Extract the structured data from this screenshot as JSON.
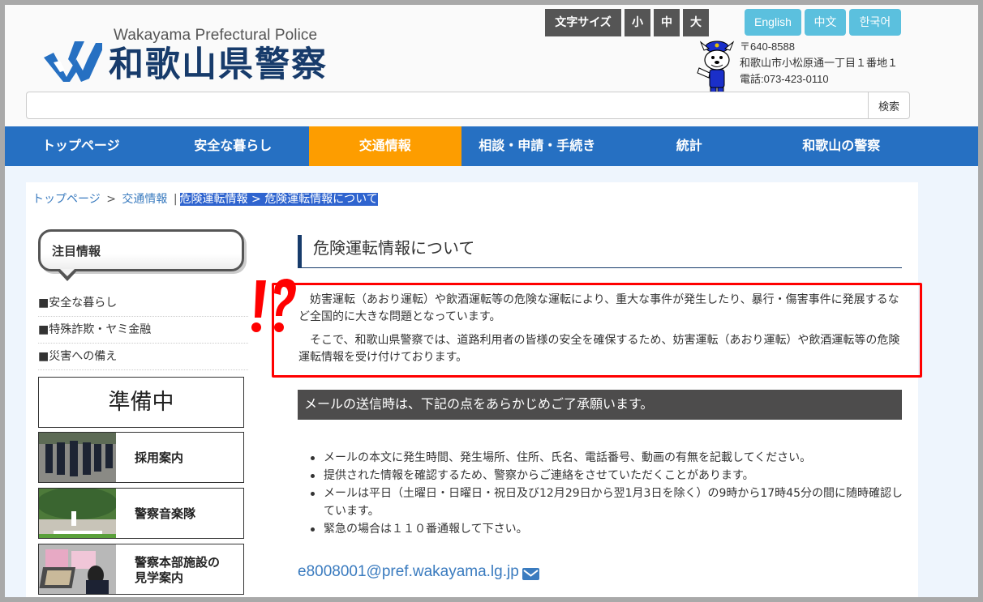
{
  "header": {
    "logo_subtitle": "Wakayama Prefectural Police",
    "logo_title": "和歌山県警察",
    "logo_icon": "w-logo-icon",
    "font_size": {
      "label": "文字サイズ",
      "small": "小",
      "medium": "中",
      "large": "大"
    },
    "languages": [
      "English",
      "中文",
      "한국어"
    ],
    "mascot_icon": "police-mascot-icon",
    "address": {
      "postal": "〒640-8588",
      "street": "和歌山市小松原通一丁目１番地１",
      "phone": "電話:073-423-0110"
    },
    "search": {
      "value": "",
      "placeholder": "",
      "button_label": "検索"
    }
  },
  "nav": {
    "items": [
      {
        "label": "トップページ",
        "active": false
      },
      {
        "label": "安全な暮らし",
        "active": false
      },
      {
        "label": "交通情報",
        "active": true
      },
      {
        "label": "相談・申請・手続き",
        "active": false
      },
      {
        "label": "統計",
        "active": false
      },
      {
        "label": "和歌山の警察",
        "active": false
      }
    ]
  },
  "breadcrumb": {
    "items": [
      "トップページ",
      "交通情報",
      "危険運転情報",
      "危険運転情報について"
    ],
    "separator": ">",
    "divider": "|"
  },
  "sidebar": {
    "featured_title": "注目情報",
    "links": [
      "■安全な暮らし",
      "■特殊詐欺・ヤミ金融",
      "■災害への備え"
    ],
    "banners": [
      {
        "label": "準備中"
      },
      {
        "label": "採用案内"
      },
      {
        "label": "警察音楽隊"
      },
      {
        "label_line1": "警察本部施設の",
        "label_line2": "見学案内"
      }
    ]
  },
  "article": {
    "title": "危険運転情報について",
    "callout_icon": "exclamation-question-icon",
    "intro": [
      "妨害運転（あおり運転）や飲酒運転等の危険な運転により、重大な事件が発生したり、暴行・傷害事件に発展するなど全国的に大きな問題となっています。",
      "そこで、和歌山県警察では、道路利用者の皆様の安全を確保するため、妨害運転（あおり運転）や飲酒運転等の危険運転情報を受け付けております。"
    ],
    "notice_heading": "メールの送信時は、下記の点をあらかじめご了承願います。",
    "notes": [
      "メールの本文に発生時間、発生場所、住所、氏名、電話番号、動画の有無を記載してください。",
      "提供された情報を確認するため、警察からご連絡をさせていただくことがあります。",
      "メールは平日（土曜日・日曜日・祝日及び12月29日から翌1月3日を除く）の9時から17時45分の間に随時確認しています。",
      "緊急の場合は１１０番通報して下さい。"
    ],
    "email": "e8008001@pref.wakayama.lg.jp",
    "email_icon": "envelope-icon"
  },
  "colors": {
    "nav_bg": "#2670c2",
    "nav_active": "#fd9d00",
    "lang_button": "#5bc0de",
    "logo_text": "#173b6b",
    "callout_border": "#ff0000",
    "link": "#3a7bbf"
  }
}
